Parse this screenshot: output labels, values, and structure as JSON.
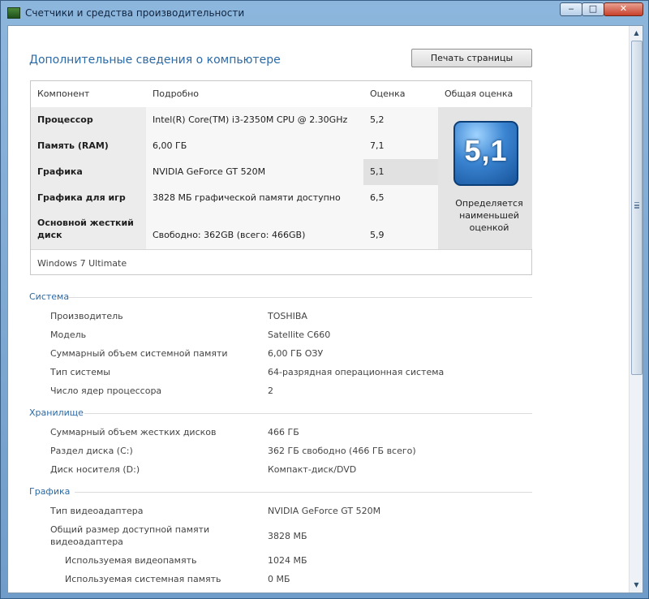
{
  "window": {
    "title": "Счетчики и средства производительности",
    "min": "‒",
    "max": "□",
    "close": "✕"
  },
  "page": {
    "heading": "Дополнительные сведения о компьютере",
    "print_button": "Печать страницы"
  },
  "table": {
    "headers": [
      "Компонент",
      "Подробно",
      "Оценка",
      "Общая оценка"
    ],
    "rows": [
      {
        "component": "Процессор",
        "detail": "Intel(R) Core(TM) i3-2350M CPU @ 2.30GHz",
        "score": "5,2"
      },
      {
        "component": "Память (RAM)",
        "detail": "6,00 ГБ",
        "score": "7,1"
      },
      {
        "component": "Графика",
        "detail": "NVIDIA GeForce GT 520M",
        "score": "5,1"
      },
      {
        "component": "Графика для игр",
        "detail": "3828 МБ графической памяти доступно",
        "score": "6,5"
      },
      {
        "component": "Основной жесткий",
        "component2": "диск",
        "detail": "Свободно: 362GB (всего: 466GB)",
        "score": "5,9"
      }
    ],
    "overall_score": "5,1",
    "overall_note": "Определяется наименьшей оценкой",
    "edition": "Windows 7 Ultimate"
  },
  "sections": {
    "system": {
      "title": "Система",
      "items": [
        {
          "label": "Производитель",
          "value": "TOSHIBA"
        },
        {
          "label": "Модель",
          "value": "Satellite C660"
        },
        {
          "label": "Суммарный объем системной памяти",
          "value": "6,00 ГБ ОЗУ"
        },
        {
          "label": "Тип системы",
          "value": "64-разрядная операционная система"
        },
        {
          "label": "Число ядер процессора",
          "value": "2"
        }
      ]
    },
    "storage": {
      "title": "Хранилище",
      "items": [
        {
          "label": "Суммарный объем жестких дисков",
          "value": "466 ГБ"
        },
        {
          "label": "Раздел диска (C:)",
          "value": "362 ГБ свободно (466 ГБ всего)"
        },
        {
          "label": "Диск носителя (D:)",
          "value": "Компакт-диск/DVD"
        }
      ]
    },
    "graphics": {
      "title": "Графика",
      "items": [
        {
          "label": "Тип видеоадаптера",
          "value": "NVIDIA GeForce GT 520M"
        },
        {
          "label": "Общий размер доступной памяти",
          "label2": "видеоадаптера",
          "value": "3828 МБ"
        },
        {
          "label": "Используемая видеопамять",
          "value": "1024 МБ"
        },
        {
          "label": "Используемая системная память",
          "value": "0 МБ"
        }
      ]
    }
  }
}
